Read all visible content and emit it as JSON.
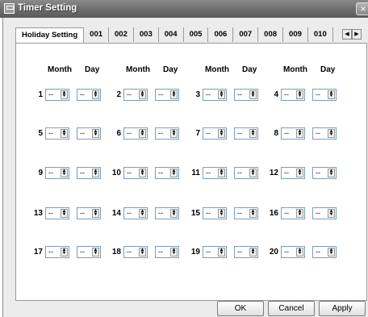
{
  "window": {
    "title": "Timer Setting",
    "close_label": "×"
  },
  "tabs": [
    "Holiday Setting",
    "001",
    "002",
    "003",
    "004",
    "005",
    "006",
    "007",
    "008",
    "009",
    "010"
  ],
  "tab_nav": {
    "left": "◀",
    "right": "▶"
  },
  "panel": {
    "headers": [
      "Month",
      "Day"
    ],
    "rows": [
      [
        "1",
        "2",
        "3",
        "4"
      ],
      [
        "5",
        "6",
        "7",
        "8"
      ],
      [
        "9",
        "10",
        "11",
        "12"
      ],
      [
        "13",
        "14",
        "15",
        "16"
      ],
      [
        "17",
        "18",
        "19",
        "20"
      ]
    ],
    "month_value": "--",
    "day_value": "--"
  },
  "buttons": {
    "ok": "OK",
    "cancel": "Cancel",
    "apply": "Apply"
  }
}
